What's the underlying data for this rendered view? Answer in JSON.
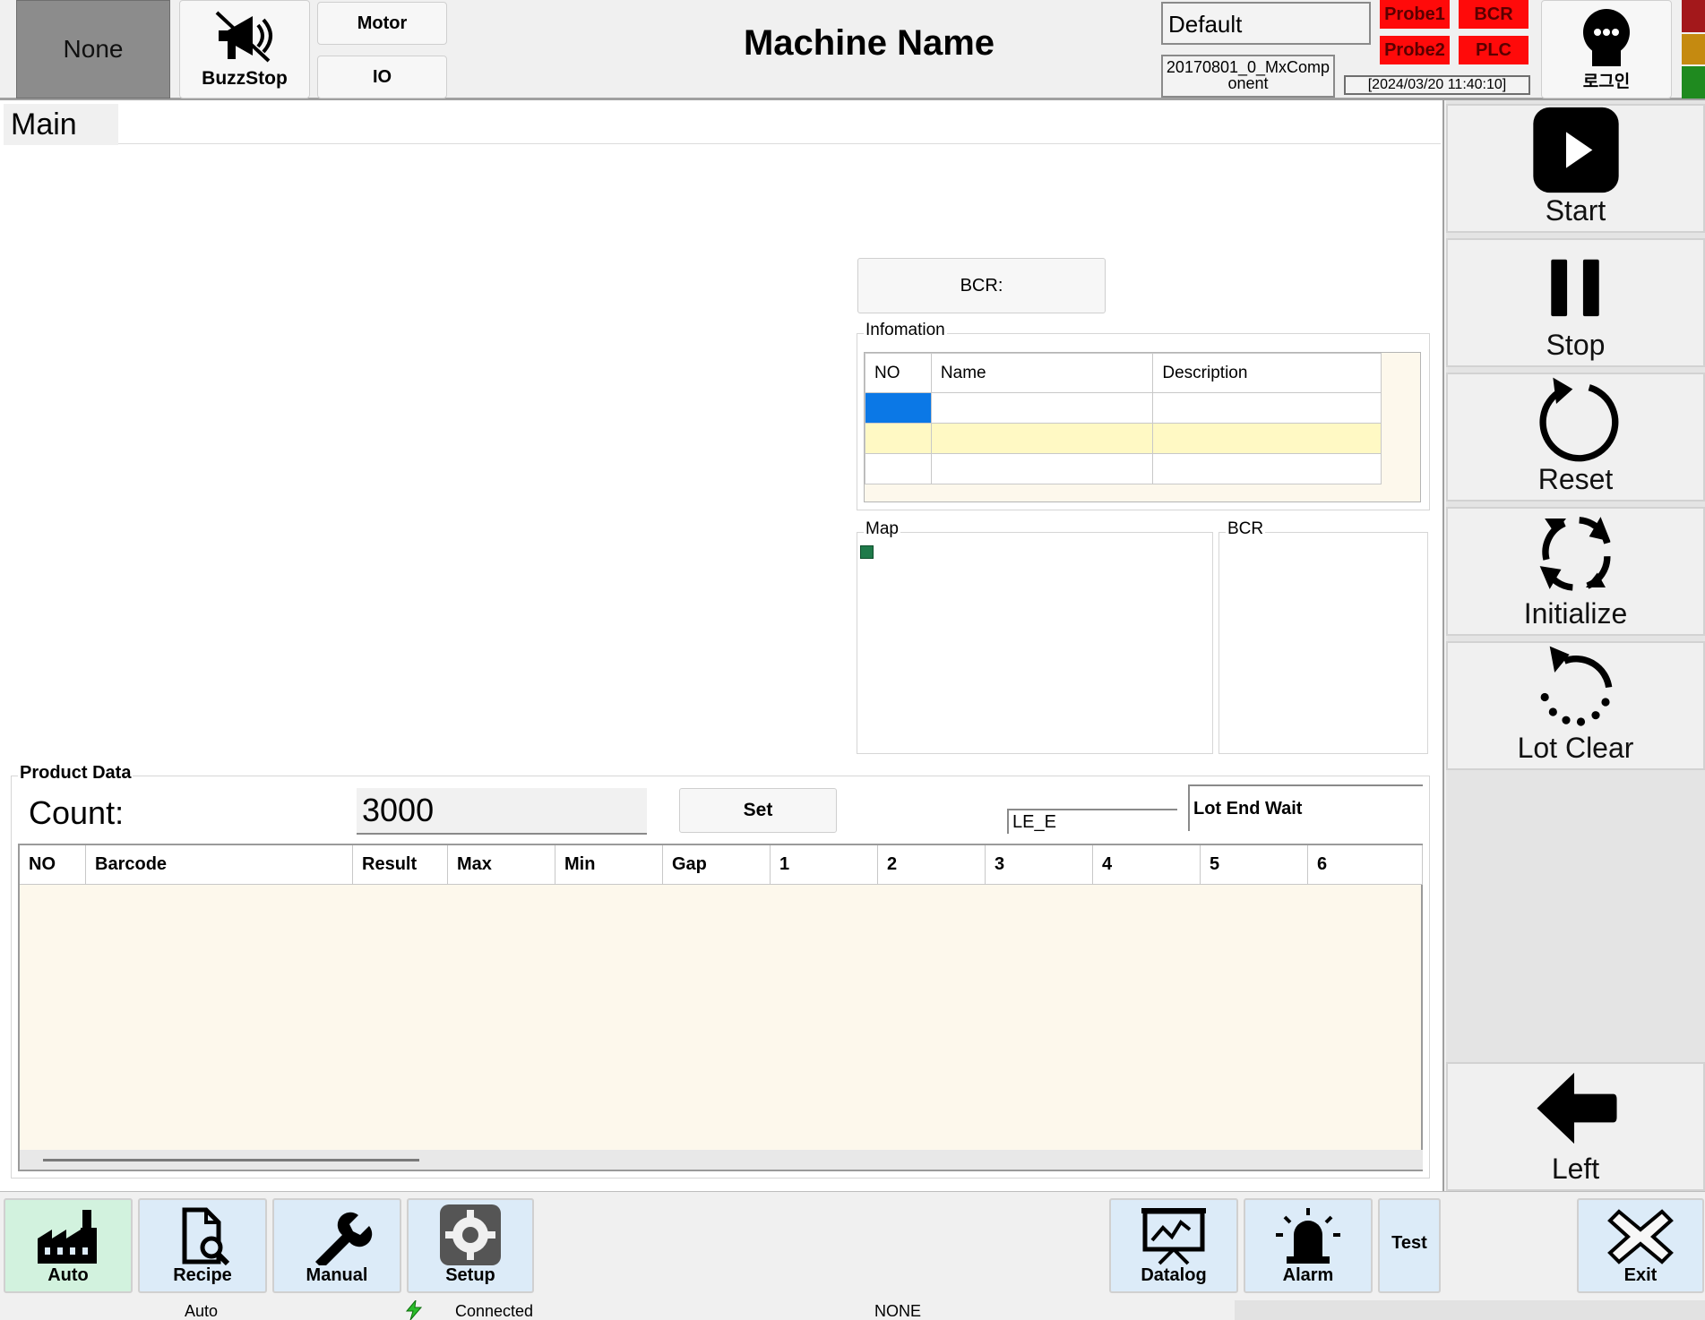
{
  "header": {
    "mode": "None",
    "buzz_stop": "BuzzStop",
    "motor": "Motor",
    "io": "IO",
    "machine_name": "Machine Name",
    "recipe": "Default",
    "version": "20170801_0_MxComp onent",
    "status": {
      "probe1": "Probe1",
      "bcr": "BCR",
      "probe2": "Probe2",
      "plc": "PLC"
    },
    "status_color": "#ff0a0a",
    "clock": "[2024/03/20 11:40:10]",
    "login": "로그인",
    "lamps": [
      "#a3181b",
      "#c58a10",
      "#1f8a1f"
    ]
  },
  "main": {
    "tab": "Main",
    "bcr_button": "BCR:",
    "information": {
      "legend": "Infomation",
      "columns": [
        "NO",
        "Name",
        "Description"
      ],
      "rows": [
        [
          "",
          "",
          ""
        ],
        [
          "",
          "",
          ""
        ],
        [
          "",
          "",
          ""
        ]
      ],
      "row_colors": [
        "#0b78e6",
        "#fff9c4",
        "#ffffff"
      ]
    },
    "map_legend": "Map",
    "bcr_legend": "BCR"
  },
  "product_data": {
    "legend": "Product Data",
    "count_label": "Count:",
    "count_value": "3000",
    "set_label": "Set",
    "lot_field": "LE_E",
    "lot_status": "Lot End Wait",
    "columns": [
      "NO",
      "Barcode",
      "Result",
      "Max",
      "Min",
      "Gap",
      "1",
      "2",
      "3",
      "4",
      "5",
      "6"
    ]
  },
  "side_buttons": [
    {
      "label": "Start",
      "icon": "play-icon"
    },
    {
      "label": "Stop",
      "icon": "pause-icon"
    },
    {
      "label": "Reset",
      "icon": "reset-icon"
    },
    {
      "label": "Initialize",
      "icon": "refresh-icon"
    },
    {
      "label": "Lot Clear",
      "icon": "lot-clear-icon"
    },
    {
      "label": "Left",
      "icon": "arrow-left-icon"
    }
  ],
  "nav": {
    "auto": "Auto",
    "recipe": "Recipe",
    "manual": "Manual",
    "setup": "Setup",
    "datalog": "Datalog",
    "alarm": "Alarm",
    "test": "Test",
    "exit": "Exit"
  },
  "status_bar": {
    "mode": "Auto",
    "connection": "Connected",
    "state": "NONE"
  }
}
